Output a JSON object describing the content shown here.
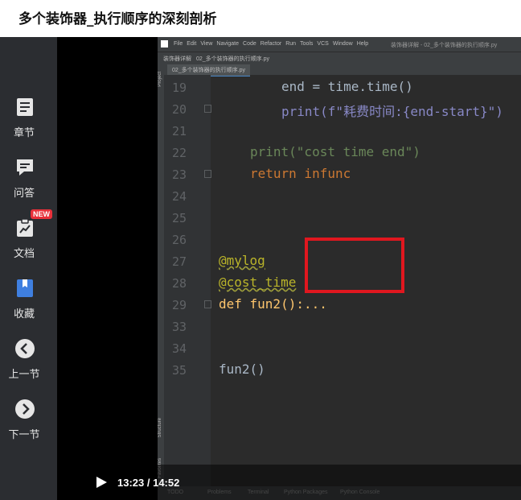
{
  "page": {
    "title": "多个装饰器_执行顺序的深刻剖析"
  },
  "sidebar": {
    "items": [
      {
        "label": "章节",
        "icon": "chapters-icon"
      },
      {
        "label": "问答",
        "icon": "qa-icon"
      },
      {
        "label": "文档",
        "icon": "document-icon",
        "badge": "NEW"
      },
      {
        "label": "收藏",
        "icon": "bookmark-icon"
      },
      {
        "label": "上一节",
        "icon": "previous-icon"
      },
      {
        "label": "下一节",
        "icon": "next-icon"
      }
    ]
  },
  "ide": {
    "menus": [
      "File",
      "Edit",
      "View",
      "Navigate",
      "Code",
      "Refactor",
      "Run",
      "Tools",
      "VCS",
      "Window",
      "Help"
    ],
    "window_title": "装饰器详解 - 02_多个装饰器的执行顺序.py",
    "breadcrumb_project": "装饰器详解",
    "breadcrumb_file": "02_多个装饰器的执行顺序.py",
    "tab_file": "02_多个装饰器的执行顺序.py",
    "side_labels": {
      "project": "Project",
      "structure": "Structure",
      "favorites": "Favorites"
    },
    "status_tabs": [
      "TODO",
      "Problems",
      "Terminal",
      "Python Packages",
      "Python Console"
    ],
    "code_lines": [
      {
        "num": "19",
        "text": "end = time.time()"
      },
      {
        "num": "20",
        "text": "print(f\"耗费时间:{end-start}\")"
      },
      {
        "num": "21",
        "text": ""
      },
      {
        "num": "22",
        "text": "print(\"cost time end\")"
      },
      {
        "num": "23",
        "text": "return infunc"
      },
      {
        "num": "24",
        "text": ""
      },
      {
        "num": "25",
        "text": ""
      },
      {
        "num": "26",
        "text": ""
      },
      {
        "num": "27",
        "text": "@mylog"
      },
      {
        "num": "28",
        "text": "@cost_time"
      },
      {
        "num": "29",
        "text": "def fun2():..."
      },
      {
        "num": "33",
        "text": ""
      },
      {
        "num": "34",
        "text": ""
      },
      {
        "num": "35",
        "text": "fun2()"
      }
    ]
  },
  "player": {
    "current_time": "13:23",
    "separator": " / ",
    "duration": "14:52"
  },
  "colors": {
    "sidebar_bg": "#2b2d31",
    "editor_bg": "#2b2b2b",
    "highlight_box": "#e0171f",
    "badge": "#e8303a"
  }
}
